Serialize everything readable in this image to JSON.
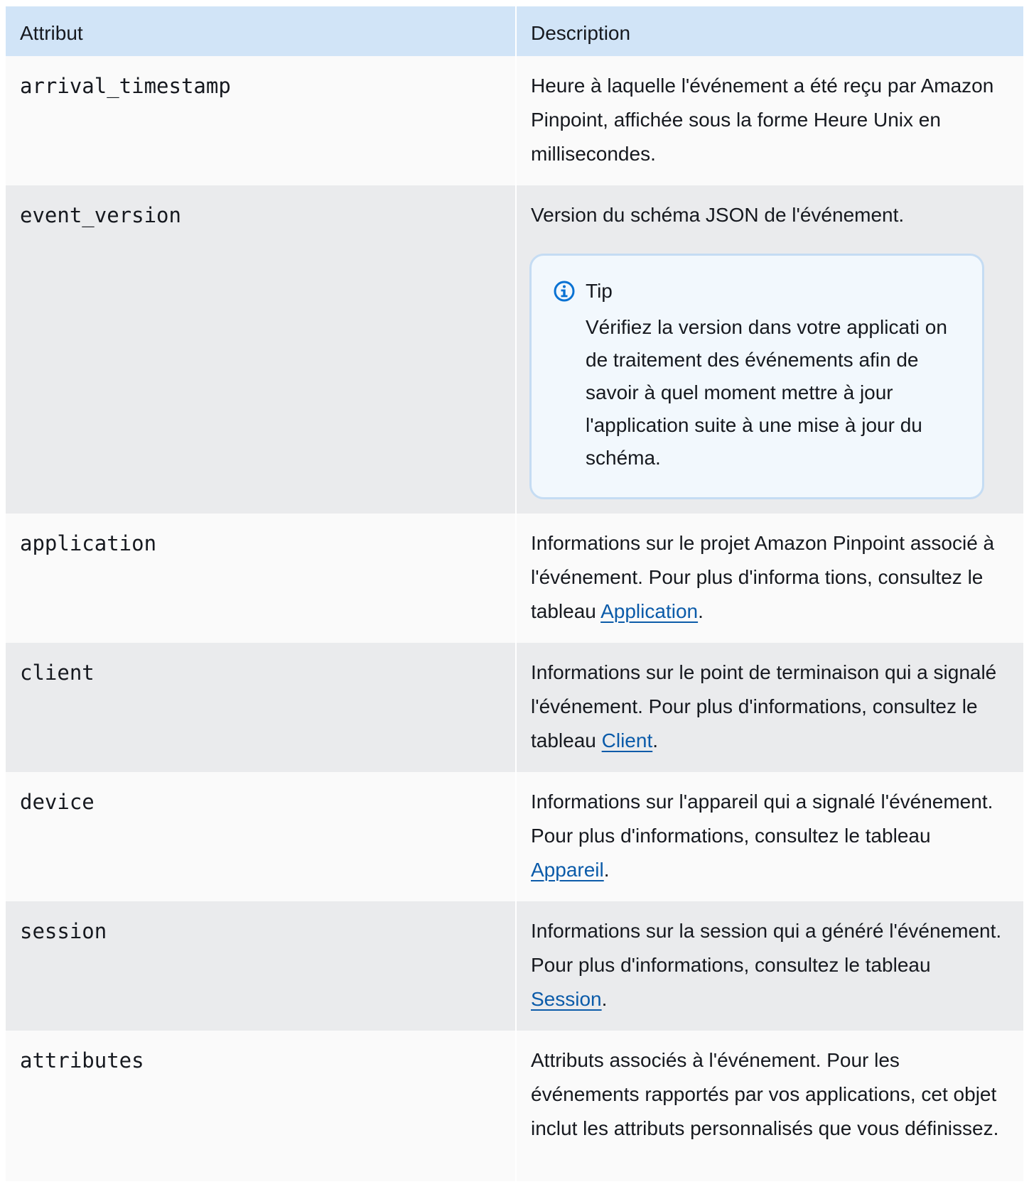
{
  "table": {
    "headers": {
      "attribute": "Attribut",
      "description": "Description"
    },
    "rows": [
      {
        "attribute": "arrival_timestamp",
        "description": "Heure à laquelle l'événement a été reçu par Amazon Pinpoint, affichée sous la forme Heure Unix en millisecondes."
      },
      {
        "attribute": "event_version",
        "description": "Version du schéma JSON de l'événement.",
        "tip": {
          "icon": "info-icon",
          "title": "Tip",
          "body": "Vérifiez la version dans votre applicati on de traitement des événements afin de savoir à quel moment mettre à jour l'application suite à une mise à jour du schéma."
        }
      },
      {
        "attribute": "application",
        "description_before": "Informations sur le projet Amazon Pinpoint associé à l'événement. Pour plus d'informa tions, consultez le tableau ",
        "link_text": "Application",
        "description_after": "."
      },
      {
        "attribute": "client",
        "description_before": "Informations sur le point de terminaison qui a signalé l'événement. Pour plus d'informations, consultez le tableau ",
        "link_text": "Client",
        "description_after": "."
      },
      {
        "attribute": "device",
        "description_before": "Informations sur l'appareil qui a signalé l'événement. Pour plus d'informations, consultez le tableau ",
        "link_text": "Appareil",
        "description_after": "."
      },
      {
        "attribute": "session",
        "description_before": "Informations sur la session qui a généré l'événement. Pour plus d'informations, consultez le tableau ",
        "link_text": "Session",
        "description_after": "."
      },
      {
        "attribute": "attributes",
        "description": "Attributs associés à l'événement. Pour les événements rapportés par vos applications, cet objet inclut les attributs personnalisés que vous définissez."
      }
    ]
  },
  "colors": {
    "header_bg": "#d1e4f7",
    "row_light": "#fafafa",
    "row_dark": "#eaebed",
    "link": "#0b5ba9",
    "tip_bg": "#f2f8fd",
    "tip_border": "#c5dcf3",
    "info_icon": "#0972d3"
  }
}
